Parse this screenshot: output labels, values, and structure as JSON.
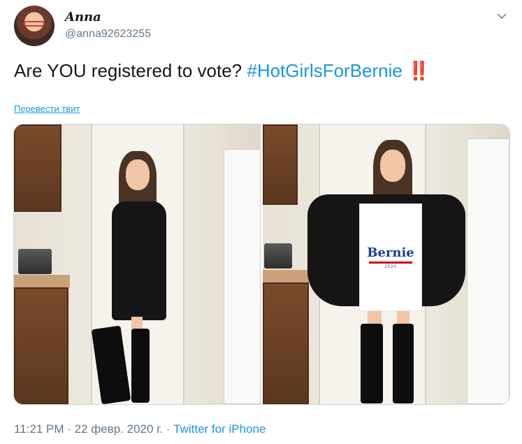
{
  "author": {
    "display_name": "Anna",
    "handle": "@anna92623255"
  },
  "tweet": {
    "text_main": "Are YOU registered to vote? ",
    "hashtag": "#HotGirlsForBernie",
    "emoji": "‼️"
  },
  "translate_link": "Перевести твит",
  "media": {
    "sign_title": "Bernie",
    "sign_year": "2020"
  },
  "meta": {
    "time": "11:21 PM",
    "separator": " · ",
    "date": "22 февр. 2020 г.",
    "source": "Twitter for iPhone"
  },
  "icons": {
    "menu": "chevron-down-icon"
  },
  "colors": {
    "link": "#1b95e0",
    "secondary_text": "#657786",
    "emoji_red": "#d0021b"
  }
}
